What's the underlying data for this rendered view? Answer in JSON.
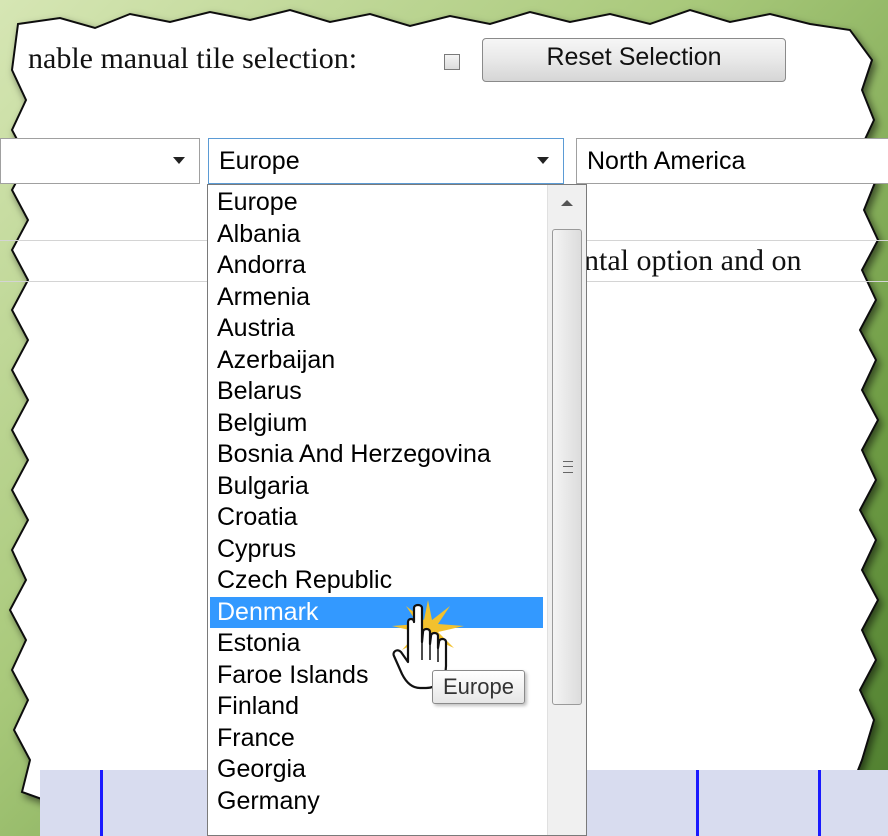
{
  "toolbar": {
    "manual_selection_label": "nable manual tile selection:",
    "manual_selection_checked": false,
    "reset_button_label": "Reset Selection"
  },
  "region_selects": {
    "left_value": "",
    "middle_value": "Europe",
    "right_value": "North America"
  },
  "body_text": "ntal option and on",
  "dropdown": {
    "options": [
      "Europe",
      "Albania",
      "Andorra",
      "Armenia",
      "Austria",
      "Azerbaijan",
      "Belarus",
      "Belgium",
      "Bosnia And Herzegovina",
      "Bulgaria",
      "Croatia",
      "Cyprus",
      "Czech Republic",
      "Denmark",
      "Estonia",
      "Faroe Islands",
      "Finland",
      "France",
      "Georgia",
      "Germany"
    ],
    "selected": "Denmark",
    "highlight_color": "#3399ff"
  },
  "tooltip": "Europe",
  "icons": {
    "cursor": "hand-pointer-icon",
    "scroll_up": "scroll-up-arrow-icon",
    "dropdown_arrow": "chevron-down-icon"
  }
}
